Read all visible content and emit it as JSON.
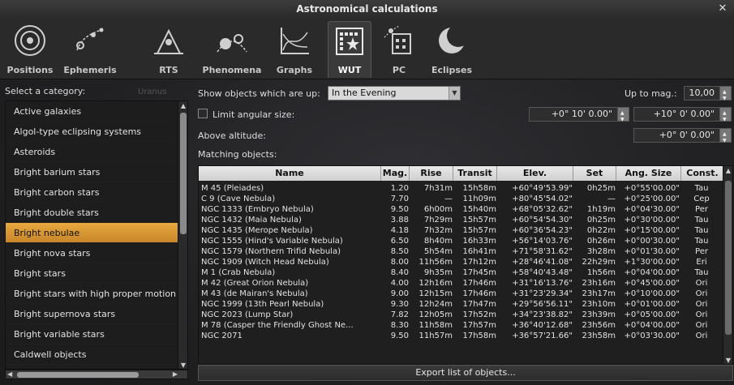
{
  "window": {
    "title": "Astronomical calculations",
    "close_label": "✕"
  },
  "tabs": [
    {
      "label": "Positions"
    },
    {
      "label": "Ephemeris"
    },
    {
      "label": "RTS"
    },
    {
      "label": "Phenomena"
    },
    {
      "label": "Graphs"
    },
    {
      "label": "WUT",
      "active": true
    },
    {
      "label": "PC"
    },
    {
      "label": "Eclipses"
    }
  ],
  "sidebar": {
    "label": "Select a category:",
    "background_word": "Uranus",
    "selected": "Bright nebulae",
    "items": [
      "Active galaxies",
      "Algol-type eclipsing systems",
      "Asteroids",
      "Bright barium stars",
      "Bright carbon stars",
      "Bright double stars",
      "Bright nebulae",
      "Bright nova stars",
      "Bright stars",
      "Bright stars with high proper motion",
      "Bright supernova stars",
      "Bright variable stars",
      "Caldwell objects"
    ]
  },
  "filters": {
    "show_label": "Show objects which are up:",
    "show_value": "In the Evening",
    "mag_label": "Up to mag.:",
    "mag_value": "10,00",
    "angular_label": "Limit angular size:",
    "angular_min": "+0° 10' 0.00\"",
    "angular_max": "+10° 0' 0.00\"",
    "altitude_label": "Above altitude:",
    "altitude_value": "+0° 0' 0.00\"",
    "matching_label": "Matching objects:"
  },
  "table": {
    "columns": [
      "Name",
      "Mag.",
      "Rise",
      "Transit",
      "Elev.",
      "Set",
      "Ang. Size",
      "Const."
    ],
    "rows": [
      [
        "M 45 (Pleiades)",
        "1.20",
        "7h31m",
        "15h58m",
        "+60°49'53.99\"",
        "0h25m",
        "+0°55'00.00\"",
        "Tau"
      ],
      [
        "C 9 (Cave Nebula)",
        "7.70",
        "—",
        "11h09m",
        "+80°45'54.02\"",
        "—",
        "+0°25'00.00\"",
        "Cep"
      ],
      [
        "NGC 1333 (Embryo Nebula)",
        "9.50",
        "6h00m",
        "15h40m",
        "+68°05'32.62\"",
        "1h19m",
        "+0°04'30.00\"",
        "Per"
      ],
      [
        "NGC 1432 (Maia Nebula)",
        "3.88",
        "7h29m",
        "15h57m",
        "+60°54'54.30\"",
        "0h25m",
        "+0°30'00.00\"",
        "Tau"
      ],
      [
        "NGC 1435 (Merope Nebula)",
        "4.18",
        "7h32m",
        "15h57m",
        "+60°36'54.23\"",
        "0h22m",
        "+0°15'00.00\"",
        "Tau"
      ],
      [
        "NGC 1555 (Hind's Variable Nebula)",
        "6.50",
        "8h40m",
        "16h33m",
        "+56°14'03.76\"",
        "0h26m",
        "+0°00'30.00\"",
        "Tau"
      ],
      [
        "NGC 1579 (Northern Trifid Nebula)",
        "8.50",
        "5h54m",
        "16h41m",
        "+71°58'31.62\"",
        "3h28m",
        "+0°01'30.00\"",
        "Per"
      ],
      [
        "NGC 1909 (Witch Head Nebula)",
        "8.00",
        "11h56m",
        "17h12m",
        "+28°46'41.08\"",
        "22h29m",
        "+1°30'00.00\"",
        "Eri"
      ],
      [
        "M 1 (Crab Nebula)",
        "8.40",
        "9h35m",
        "17h45m",
        "+58°40'43.48\"",
        "1h56m",
        "+0°04'00.00\"",
        "Tau"
      ],
      [
        "M 42 (Great Orion Nebula)",
        "4.00",
        "12h16m",
        "17h46m",
        "+31°16'13.76\"",
        "23h16m",
        "+0°45'00.00\"",
        "Ori"
      ],
      [
        "M 43 (de Mairan's Nebula)",
        "9.00",
        "12h15m",
        "17h46m",
        "+31°23'29.34\"",
        "23h17m",
        "+0°10'00.00\"",
        "Ori"
      ],
      [
        "NGC 1999 (13th Pearl Nebula)",
        "9.30",
        "12h24m",
        "17h47m",
        "+29°56'56.11\"",
        "23h10m",
        "+0°01'00.00\"",
        "Ori"
      ],
      [
        "NGC 2023 (Lump Star)",
        "7.82",
        "12h05m",
        "17h52m",
        "+34°23'38.82\"",
        "23h39m",
        "+0°05'00.00\"",
        "Ori"
      ],
      [
        "M 78 (Casper the Friendly Ghost Ne...",
        "8.30",
        "11h58m",
        "17h57m",
        "+36°40'12.68\"",
        "23h56m",
        "+0°04'00.00\"",
        "Ori"
      ],
      [
        "NGC 2071",
        "9.50",
        "11h57m",
        "17h58m",
        "+36°57'21.66\"",
        "23h58m",
        "+0°03'30.00\"",
        "Ori"
      ]
    ]
  },
  "export_button": "Export list of objects..."
}
